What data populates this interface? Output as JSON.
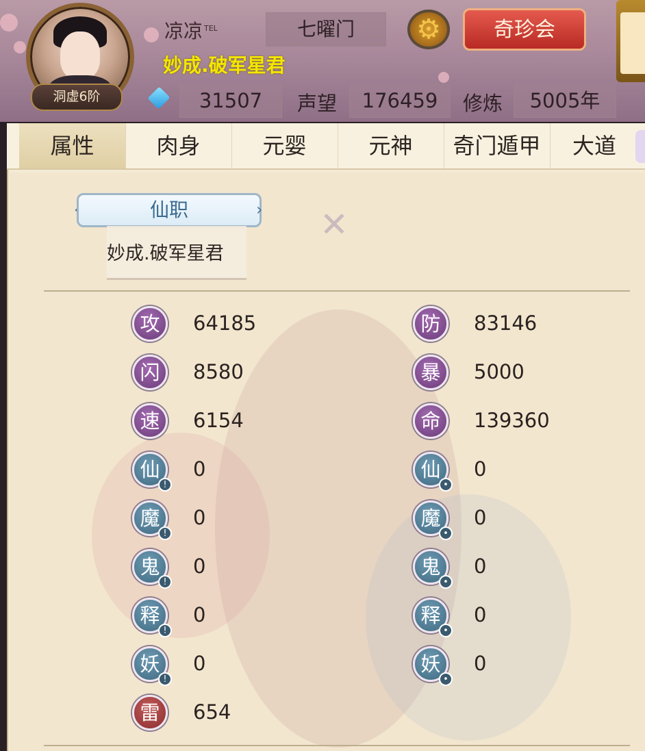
{
  "header": {
    "player_name": "凉凉",
    "tel_tag": "TEL",
    "sect": "七曜门",
    "title": "妙成.破军星君",
    "rank": "洞虚6阶",
    "shop_button": "奇珍会",
    "lantern_text": "",
    "currency_value": "31507",
    "prestige_label": "声望",
    "prestige_value": "176459",
    "cultivation_label": "修炼",
    "cultivation_value": "5005年"
  },
  "tabs": [
    "属性",
    "肉身",
    "元婴",
    "元神",
    "奇门遁甲",
    "大道"
  ],
  "active_tab": 0,
  "office": {
    "banner": "仙职",
    "name": "妙成.破军星君"
  },
  "stats_left": [
    {
      "icon": "攻",
      "value": "64185"
    },
    {
      "icon": "闪",
      "value": "8580"
    },
    {
      "icon": "速",
      "value": "6154"
    },
    {
      "icon": "仙",
      "value": "0"
    },
    {
      "icon": "魔",
      "value": "0"
    },
    {
      "icon": "鬼",
      "value": "0"
    },
    {
      "icon": "释",
      "value": "0"
    },
    {
      "icon": "妖",
      "value": "0"
    },
    {
      "icon": "雷",
      "value": "654"
    }
  ],
  "stats_right": [
    {
      "icon": "防",
      "value": "83146"
    },
    {
      "icon": "暴",
      "value": "5000"
    },
    {
      "icon": "命",
      "value": "139360"
    },
    {
      "icon": "仙",
      "value": "0"
    },
    {
      "icon": "魔",
      "value": "0"
    },
    {
      "icon": "鬼",
      "value": "0"
    },
    {
      "icon": "释",
      "value": "0"
    },
    {
      "icon": "妖",
      "value": "0"
    }
  ],
  "colors": {
    "attack_icon": "#7a4a8a",
    "element_icon": "#4f7c95",
    "thunder_icon": "#a43c3c",
    "title_yellow": "#f5e600",
    "shop_red": "#d3443a"
  },
  "icons": {
    "settings": "gear-icon",
    "currency": "diamond-icon",
    "office_emblem": "crossed-swords-icon",
    "nav_prev": "chevron-left-icon",
    "nav_next": "chevron-right-icon"
  }
}
